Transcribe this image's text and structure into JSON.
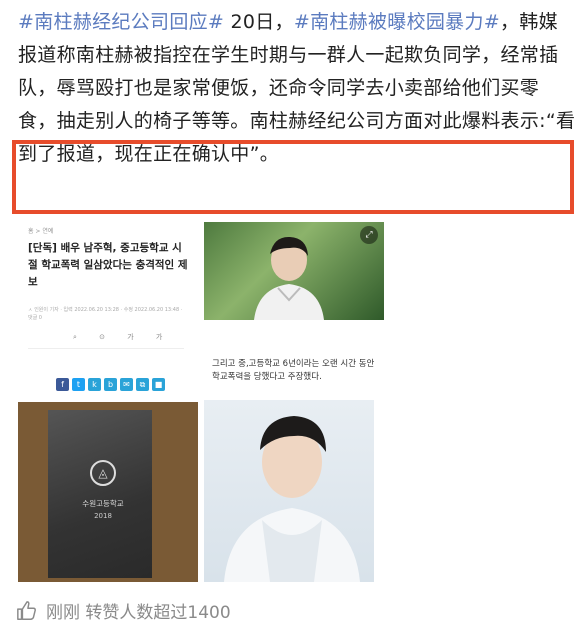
{
  "post": {
    "tag1": "#南柱赫经纪公司回应#",
    "date_text": " 20日，",
    "tag2": "#南柱赫被曝校园暴力#",
    "body_before_highlight": "，韩媒报道称南柱赫被指控在学生时期与一群人一起欺负同学，经常插队，辱骂殴打也是家常便饭，还命令同学去小卖部给他们买零食，抽走别人的椅子等等。南柱赫",
    "body_highlight": "经纪公司方面对此爆料表示:“看到了报道，现在正在确认中”。"
  },
  "article": {
    "crumb": "홈 > 연예",
    "headline": "[단독] 배우 남주혁, 중고등학교 시절 학교폭력 일삼았다는 충격적인 제보",
    "meta": "ㅅ 인원이 기자 · 입력 2022.06.20 13:28 · 수정 2022.06.20 13:48 · 댓글 0",
    "tools": "⌕ ⊙ 가 가"
  },
  "share_icons": [
    "f",
    "t",
    "k",
    "b",
    "✉",
    "⧉",
    "■"
  ],
  "caption": "그리고 중,고등학교 6년이라는 오랜 시간 동안 학교폭력을 당했다고 주장했다.",
  "plaque": {
    "school": "수원고등학교",
    "year": "2018"
  },
  "footer": {
    "text": "刚刚 转赞人数超过1400",
    "like_icon": "thumbs-up-icon"
  },
  "colors": {
    "tag": "#5b7bbf",
    "highlight_border": "#e74c2b",
    "footer_text": "#8a8a8a"
  }
}
